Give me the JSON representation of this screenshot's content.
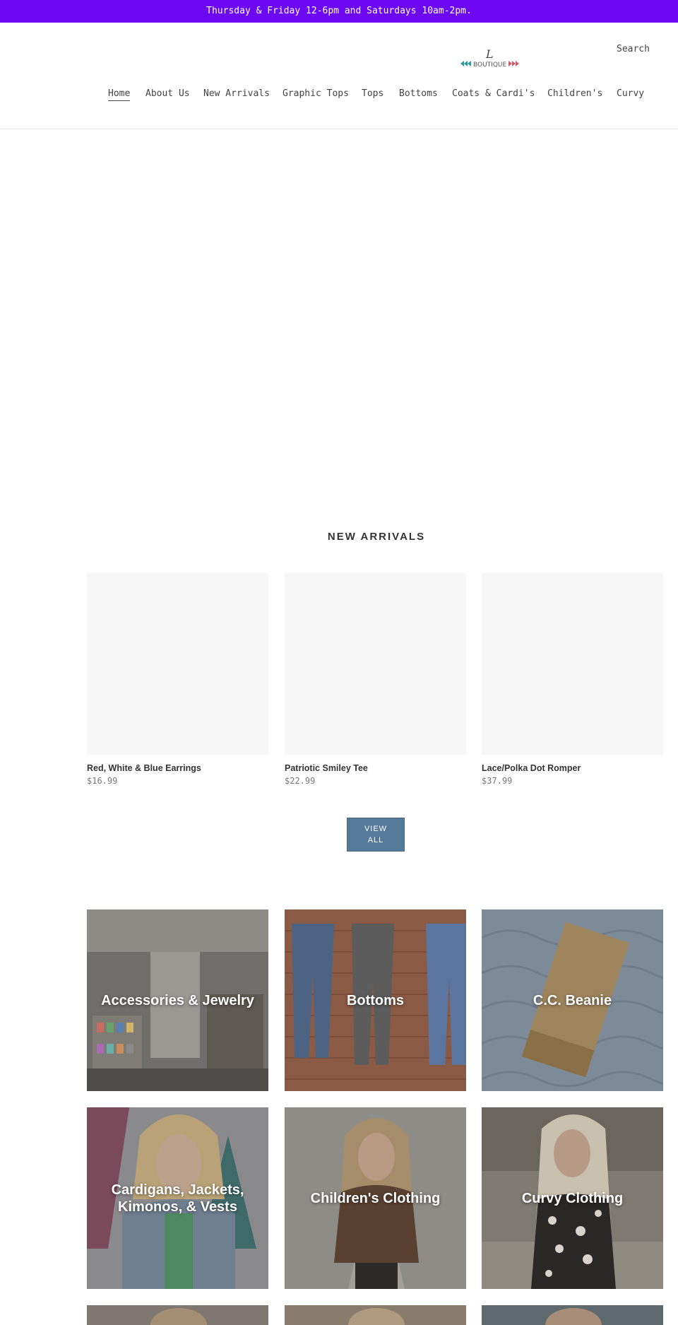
{
  "announcement": "Thursday & Friday 12-6pm and Saturdays 10am-2pm.",
  "header": {
    "logo_text": "BOUTIQUE",
    "search_label": "Search"
  },
  "nav": {
    "items": [
      "Home",
      "About Us",
      "New Arrivals",
      "Graphic Tops",
      "Tops",
      "Bottoms",
      "Coats & Cardi's",
      "Children's",
      "Curvy"
    ],
    "active": "Home"
  },
  "new_arrivals": {
    "title": "NEW ARRIVALS",
    "products": [
      {
        "name": "Red, White & Blue Earrings",
        "price": "$16.99"
      },
      {
        "name": "Patriotic Smiley Tee",
        "price": "$22.99"
      },
      {
        "name": "Lace/Polka Dot Romper",
        "price": "$37.99"
      }
    ],
    "view_all_line1": "VIEW",
    "view_all_line2": "ALL"
  },
  "collections": [
    {
      "label": "Accessories & Jewelry"
    },
    {
      "label": "Bottoms"
    },
    {
      "label": "C.C. Beanie"
    },
    {
      "label": "Cardigans, Jackets, Kimonos, & Vests"
    },
    {
      "label": "Children's Clothing"
    },
    {
      "label": "Curvy Clothing"
    }
  ],
  "colors": {
    "announcement_bg": "#6d08f5",
    "button_bg": "#557a99"
  }
}
